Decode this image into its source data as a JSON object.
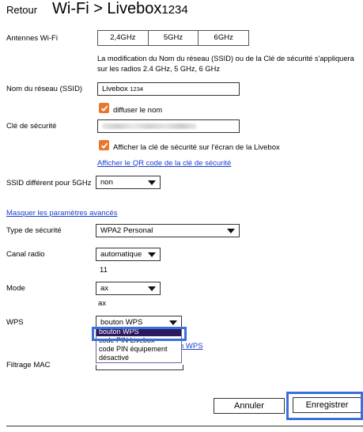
{
  "header": {
    "back_label": "Retour",
    "title": "Wi-Fi > Livebox",
    "ssid_suffix": "1234"
  },
  "antennas": {
    "label": "Antennes Wi-Fi",
    "options": [
      "2,4GHz",
      "5GHz",
      "6GHz"
    ]
  },
  "note": "La modification du Nom du réseau (SSID) ou de la Clé de sécurité s'appliquera sur les radios 2.4 GHz, 5 GHz, 6 GHz",
  "ssid": {
    "label": "Nom du réseau (SSID)",
    "value": "Livebox",
    "value_small": "1234",
    "broadcast_label": "diffuser le nom",
    "broadcast_checked": true
  },
  "key": {
    "label": "Clé de sécurité",
    "show_label": "Afficher la clé de sécurité sur l'écran de la Livebox",
    "show_checked": true,
    "qr_link": "Afficher le QR code de la clé de sécurité"
  },
  "ssid5": {
    "label": "SSID différent pour 5GHz",
    "value": "non"
  },
  "advanced_link": "Masquer les paramètres avancés",
  "security": {
    "label": "Type de sécurité",
    "value": "WPA2 Personal"
  },
  "channel": {
    "label": "Canal radio",
    "value": "automatique",
    "current": "11"
  },
  "mode": {
    "label": "Mode",
    "value": "ax",
    "current": "ax"
  },
  "wps": {
    "label": "WPS",
    "value": "bouton WPS",
    "options": [
      "bouton WPS",
      "code PIN Livebox",
      "code PIN équipement",
      "désactivé"
    ],
    "selected_index": 0,
    "link_partial": "n WPS"
  },
  "mac": {
    "label": "Filtrage MAC"
  },
  "actions": {
    "cancel": "Annuler",
    "save": "Enregistrer"
  },
  "colors": {
    "accent_orange": "#e8772e",
    "link_blue": "#1a3fd0",
    "highlight_blue": "#3b6fdc",
    "selected_option": "#2c1a5e"
  }
}
